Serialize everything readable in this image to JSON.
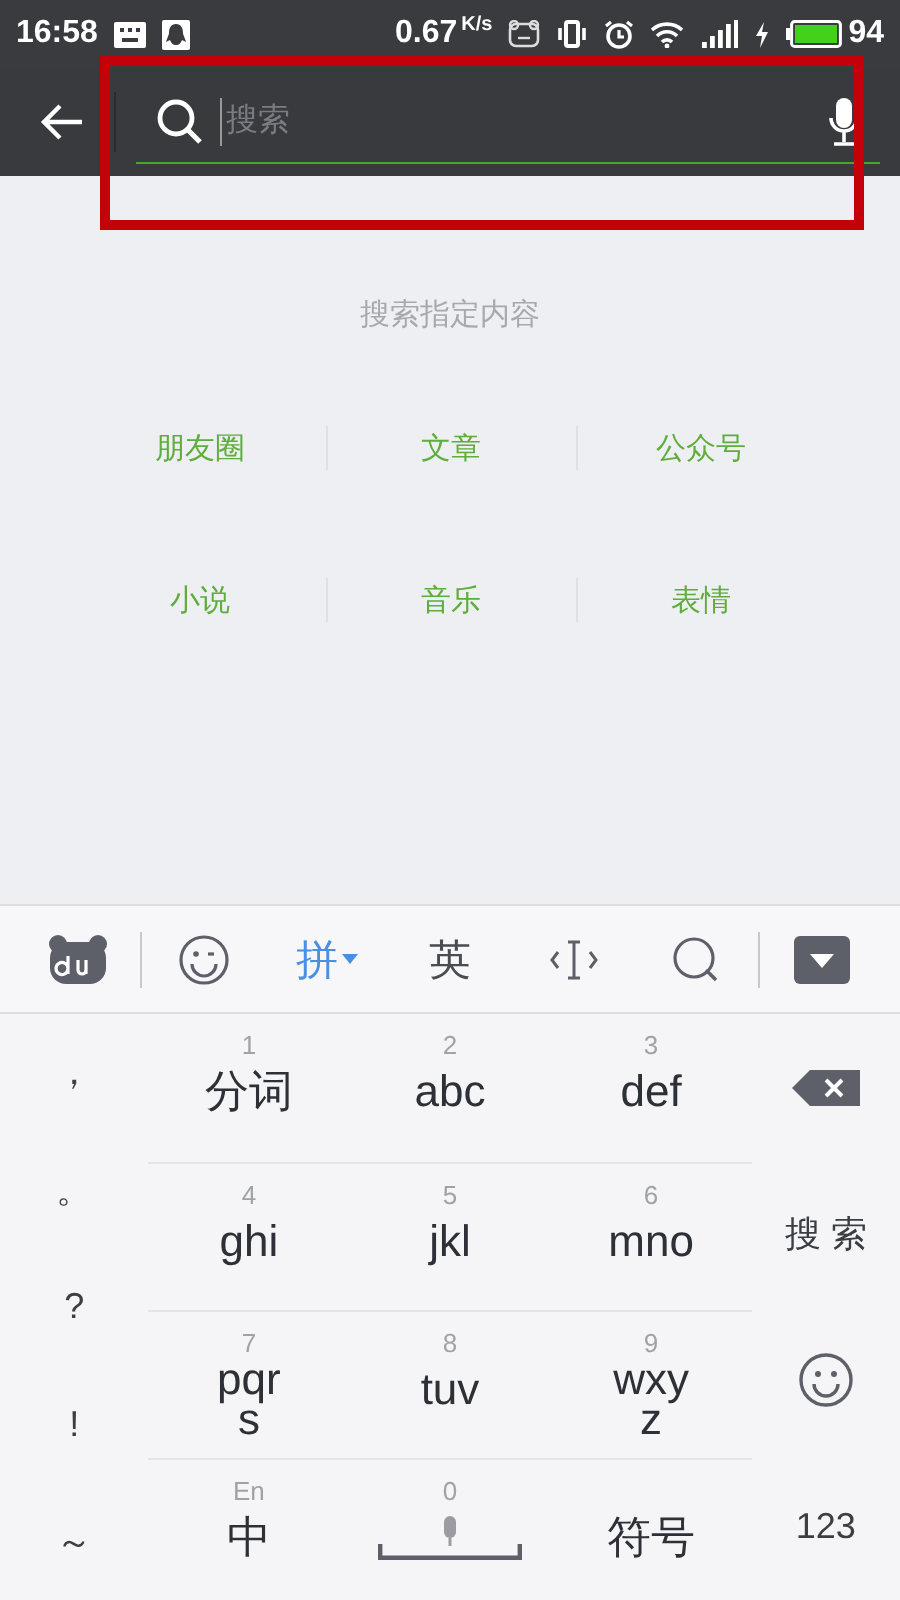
{
  "status_bar": {
    "time": "16:58",
    "speed": "0.67",
    "speed_unit": "K/s",
    "battery": "94"
  },
  "search_bar": {
    "placeholder": "搜索",
    "focused": true,
    "highlighted": true
  },
  "hint": "搜索指定内容",
  "categories": [
    {
      "label": "朋友圈"
    },
    {
      "label": "文章"
    },
    {
      "label": "公众号"
    },
    {
      "label": "小说"
    },
    {
      "label": "音乐"
    },
    {
      "label": "表情"
    }
  ],
  "keyboard_toolbar": [
    {
      "kind": "logo"
    },
    {
      "kind": "emoji"
    },
    {
      "kind": "mode",
      "label": "拼",
      "selected": true
    },
    {
      "kind": "mode",
      "label": "英",
      "selected": false
    },
    {
      "kind": "cursor"
    },
    {
      "kind": "search"
    },
    {
      "kind": "hide"
    }
  ],
  "punctuation": [
    "，",
    "。",
    "?",
    "!",
    "～"
  ],
  "keys": [
    {
      "digit": "1",
      "label": "分词"
    },
    {
      "digit": "2",
      "label": "abc"
    },
    {
      "digit": "3",
      "label": "def"
    },
    {
      "digit": "4",
      "label": "ghi"
    },
    {
      "digit": "5",
      "label": "jkl"
    },
    {
      "digit": "6",
      "label": "mno"
    },
    {
      "digit": "7",
      "label": "pqrs"
    },
    {
      "digit": "8",
      "label": "tuv"
    },
    {
      "digit": "9",
      "label": "wxyz"
    },
    {
      "digit": "En",
      "label": "中"
    },
    {
      "digit": "0",
      "kind": "space"
    },
    {
      "label": "符号"
    }
  ],
  "side_keys": [
    {
      "kind": "delete"
    },
    {
      "kind": "text",
      "label": "搜 索"
    },
    {
      "kind": "emoji"
    },
    {
      "kind": "text",
      "label": "123"
    }
  ]
}
